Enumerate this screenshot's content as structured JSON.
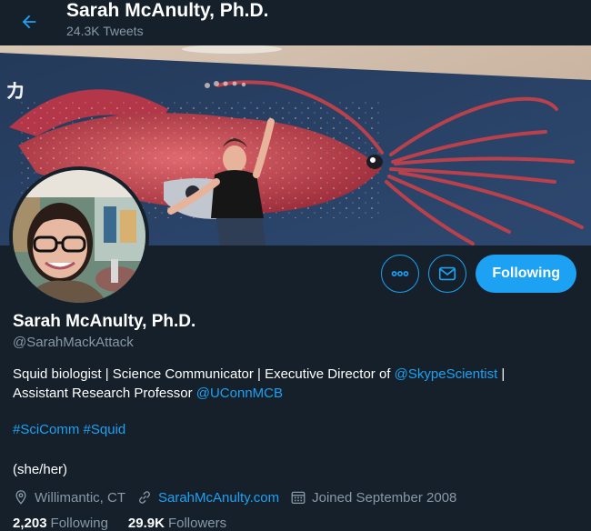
{
  "header": {
    "title": "Sarah McAnulty, Ph.D.",
    "subtitle": "24.3K Tweets"
  },
  "actions": {
    "more_icon": "more-horizontal-icon",
    "message_icon": "envelope-icon",
    "follow_label": "Following"
  },
  "profile": {
    "name": "Sarah McAnulty, Ph.D.",
    "handle": "@SarahMackAttack",
    "bio_line1_text": "Squid biologist | Science Communicator | Executive Director of ",
    "bio_line1_link": "@SkypeScientist",
    "bio_line1_tail": " |",
    "bio_line2_text": "Assistant Research Professor ",
    "bio_line2_link": "@UConnMCB",
    "hashtag1": "#SciComm",
    "hashtag2": "#Squid",
    "pronouns": "(she/her)",
    "location": "Willimantic, CT",
    "website": "SarahMcAnulty.com",
    "joined": "Joined September 2008"
  },
  "counts": {
    "following_num": "2,203",
    "following_label": "Following",
    "followers_num": "29.9K",
    "followers_label": "Followers"
  },
  "banner_text": "カ",
  "colors": {
    "background": "#15202b",
    "accent": "#1da1f2",
    "muted": "#8899a6"
  }
}
